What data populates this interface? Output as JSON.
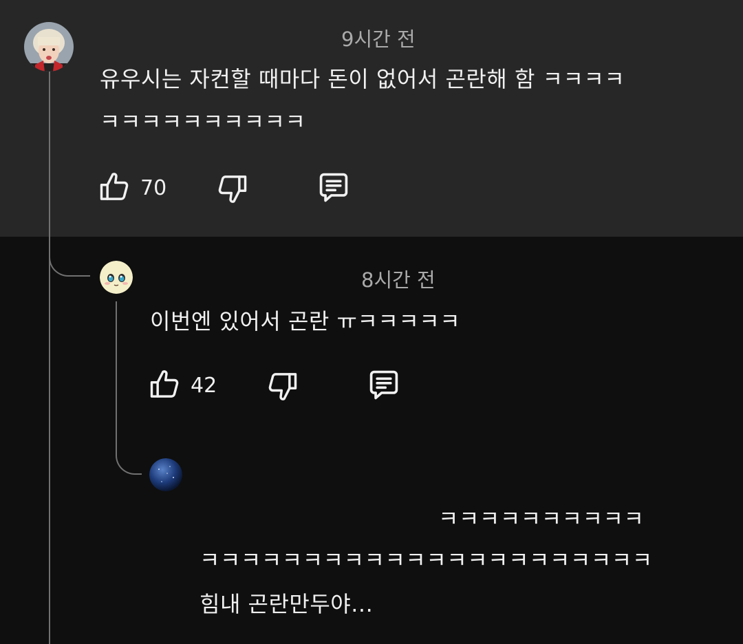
{
  "comment": {
    "timestamp": "9시간 전",
    "text_line1": "유우시는 자컨할 때마다 돈이 없어서 곤란해 함 ㅋㅋㅋㅋ",
    "text_line2": "ㅋㅋㅋㅋㅋㅋㅋㅋㅋㅋ",
    "like_count": "70"
  },
  "reply1": {
    "timestamp": "8시간 전",
    "text": "이번엔 있어서 곤란 ㅠㅋㅋㅋㅋㅋ",
    "like_count": "42"
  },
  "reply2": {
    "text_line1": "ㅋㅋㅋㅋㅋㅋㅋㅋㅋㅋ",
    "text_line2": "ㅋㅋㅋㅋㅋㅋㅋㅋㅋㅋㅋㅋㅋㅋㅋㅋㅋㅋㅋㅋㅋㅋ",
    "text_line3": "힘내 곤란만두야..."
  },
  "icons": [
    "like-icon",
    "dislike-icon",
    "reply-icon"
  ],
  "colors": {
    "top_background": "#272727",
    "page_background": "#0f0f0f",
    "thread_line": "#717171",
    "meta_text": "#aaaaaa"
  }
}
